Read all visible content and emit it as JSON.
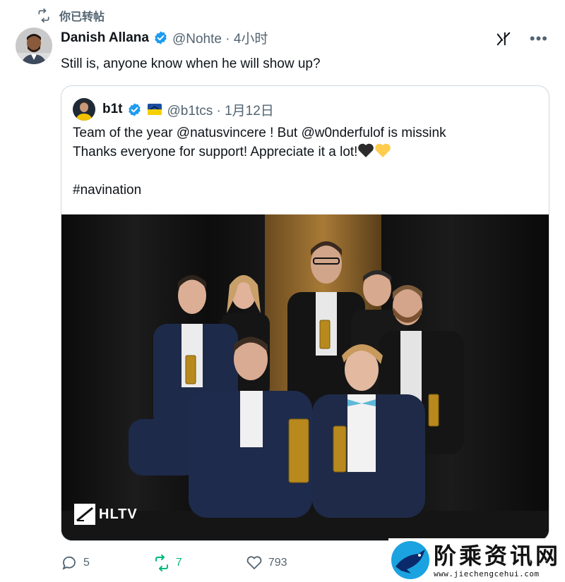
{
  "repost_banner": {
    "label": "你已转帖",
    "icon": "repost-icon"
  },
  "tweet": {
    "author_name": "Danish Allana",
    "handle_time": "@Nohte · 4小时",
    "text": "Still is, anyone know when he will show up?",
    "verified_color": "#1d9bf0"
  },
  "quote": {
    "author_name": "b1t",
    "handle_time": "@b1tcs · 1月12日",
    "lines": [
      "Team of the year @natusvincere ! But @w0nderfulof is missink",
      "Thanks everyone for support! Appreciate it a lot!",
      "",
      "#navination"
    ],
    "emojis": [
      "black-heart",
      "yellow-heart"
    ],
    "media_watermark": "HLTV"
  },
  "actions": {
    "replies": "5",
    "reposts": "7",
    "likes": "793",
    "repost_active_color": "#00ba7c"
  },
  "site_watermark": {
    "title": "阶乘资讯网",
    "url": "www.jiechengcehui.com"
  }
}
